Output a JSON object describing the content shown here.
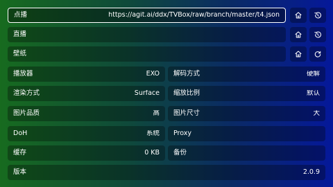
{
  "rows": {
    "vod": {
      "label": "点播",
      "value": "https://agit.ai/ddx/TVBox/raw/branch/master/t4.json"
    },
    "live": {
      "label": "直播",
      "value": ""
    },
    "wallpaper": {
      "label": "壁纸",
      "value": ""
    }
  },
  "settings": {
    "player": {
      "label": "播放器",
      "value": "EXO"
    },
    "decode": {
      "label": "解码方式",
      "value": "硬解"
    },
    "render": {
      "label": "渲染方式",
      "value": "Surface"
    },
    "scale": {
      "label": "缩放比例",
      "value": "默认"
    },
    "image_quality": {
      "label": "图片品质",
      "value": "高"
    },
    "image_size": {
      "label": "图片尺寸",
      "value": "大"
    },
    "doh": {
      "label": "DoH",
      "value": "系统"
    },
    "proxy": {
      "label": "Proxy",
      "value": ""
    },
    "cache": {
      "label": "缓存",
      "value": "0 KB"
    },
    "backup": {
      "label": "备份",
      "value": ""
    },
    "version": {
      "label": "版本",
      "value": "2.0.9"
    }
  },
  "icons": {
    "home": "home-icon",
    "history": "history-icon",
    "refresh": "refresh-icon"
  },
  "colors": {
    "gradient_left": "#176b1f",
    "gradient_right": "#05189a",
    "focus_border": "#ffffff"
  }
}
